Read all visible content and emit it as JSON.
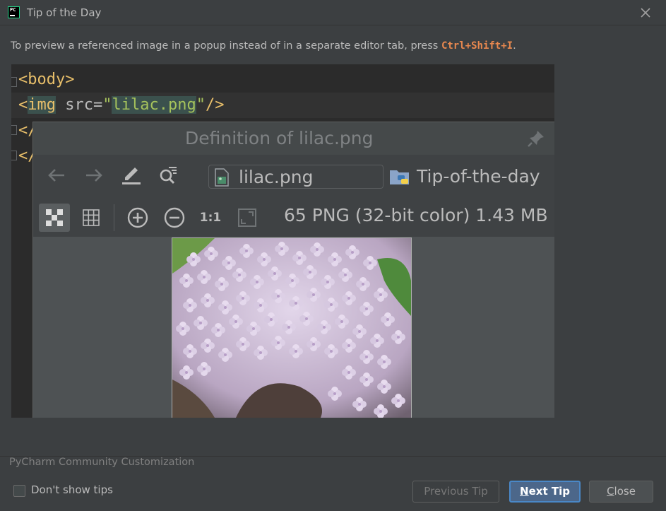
{
  "window": {
    "title": "Tip of the Day",
    "app_icon_label": "PC"
  },
  "tip": {
    "text_before": "To preview a referenced image in a popup instead of in a separate editor tab, press ",
    "shortcut": "Ctrl+Shift+I",
    "text_after": "."
  },
  "code": {
    "line1_tag": "<body>",
    "line2_open": "<",
    "line2_tag": "img",
    "line2_attr": " src=",
    "line2_quote_open": "\"",
    "line2_value": "lilac.png",
    "line2_quote_close": "\"",
    "line2_close": "/>",
    "line3_tag": "</",
    "line4_tag": "</"
  },
  "popup": {
    "title": "Definition of lilac.png",
    "file_name": "lilac.png",
    "project_name": "Tip-of-the-day",
    "image_info": "65 PNG (32-bit color) 1.43 MB",
    "actual_size_label": "1:1"
  },
  "footer": {
    "customization": "PyCharm Community Customization",
    "dont_show_label": "Don't show tips",
    "dont_show_checked": false,
    "prev_label": "Previous Tip",
    "next_label_first": "N",
    "next_label_rest": "ext Tip",
    "close_label_first": "C",
    "close_label_rest": "lose"
  },
  "colors": {
    "background": "#3c3f41",
    "editor_bg": "#2b2b2b",
    "tag": "#e8bf6a",
    "string": "#a5c25c",
    "shortcut": "#e8884f",
    "accent": "#4a88c7"
  }
}
